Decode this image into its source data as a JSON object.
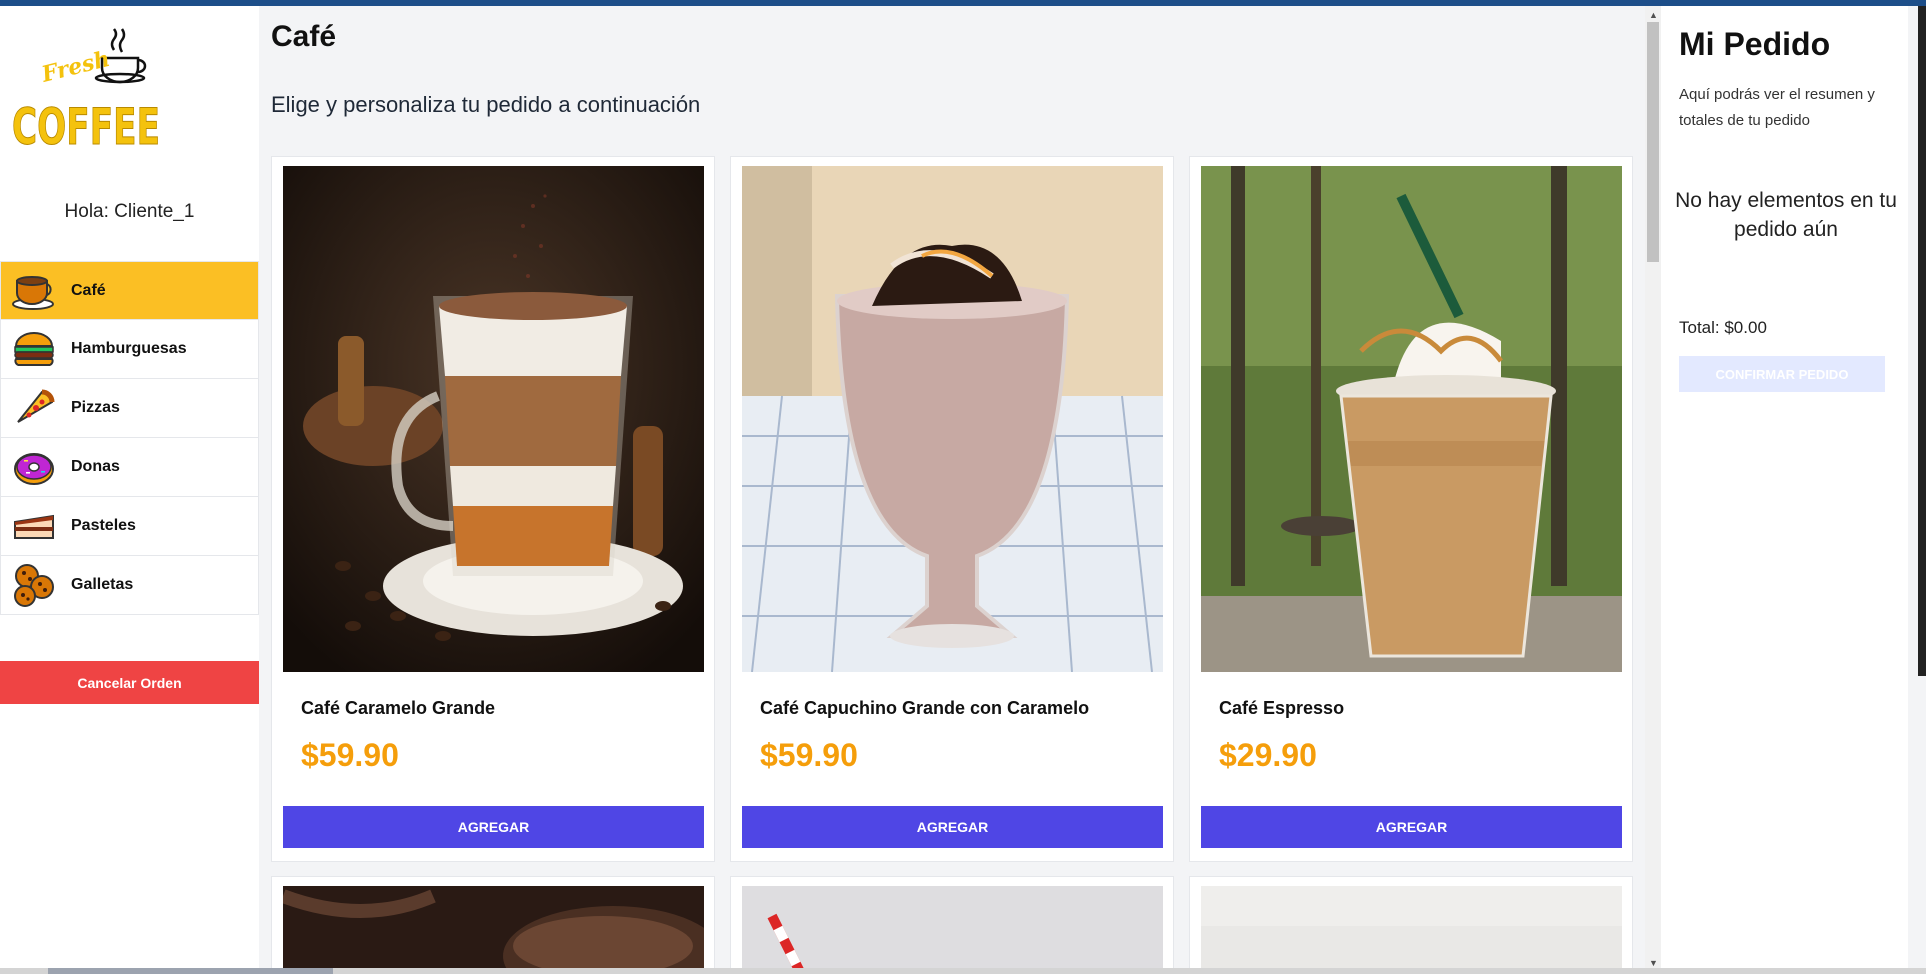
{
  "sidebar": {
    "logo_text_top": "Fresh",
    "logo_text_main": "COFFEE",
    "greeting": "Hola: Cliente_1",
    "categories": [
      {
        "label": "Café",
        "icon": "coffee-cup-icon",
        "active": true
      },
      {
        "label": "Hamburguesas",
        "icon": "burger-icon",
        "active": false
      },
      {
        "label": "Pizzas",
        "icon": "pizza-icon",
        "active": false
      },
      {
        "label": "Donas",
        "icon": "donut-icon",
        "active": false
      },
      {
        "label": "Pasteles",
        "icon": "cake-icon",
        "active": false
      },
      {
        "label": "Galletas",
        "icon": "cookies-icon",
        "active": false
      }
    ],
    "cancel_label": "Cancelar Orden"
  },
  "main": {
    "title": "Café",
    "subtitle": "Elige y personaliza tu pedido a continuación",
    "add_label": "AGREGAR",
    "products": [
      {
        "name": "Café Caramelo Grande",
        "price": "$59.90",
        "image": "latte-photo"
      },
      {
        "name": "Café Capuchino Grande con Caramelo",
        "price": "$59.90",
        "image": "frappe-photo"
      },
      {
        "name": "Café Espresso",
        "price": "$29.90",
        "image": "iced-coffee-photo"
      }
    ]
  },
  "order": {
    "title": "Mi Pedido",
    "description": "Aquí podrás ver el resumen y totales de tu pedido",
    "empty_message": "No hay elementos en tu pedido aún",
    "total": "Total: $0.00",
    "confirm_label": "CONFIRMAR PEDIDO"
  },
  "colors": {
    "accent_active": "#fbbf24",
    "primary_button": "#4f46e5",
    "cancel_button": "#ef4444",
    "price": "#f59e0b"
  }
}
